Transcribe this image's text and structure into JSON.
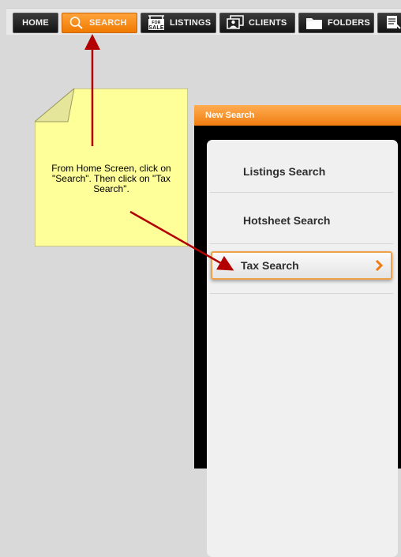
{
  "toolbar": {
    "home": "HOME",
    "search": "SEARCH",
    "listings": "LISTINGS",
    "clients": "CLIENTS",
    "folders": "FOLDERS",
    "for_sale_icon_text": [
      "FOR",
      "SALE"
    ]
  },
  "panel": {
    "title": "New Search",
    "items": [
      "Listings Search",
      "Hotsheet Search",
      "Tax Search"
    ]
  },
  "callout": {
    "text": "From Home Screen, click on \"Search\". Then click on \"Tax Search\"."
  },
  "colors": {
    "accent": "#f07d10",
    "note_fill": "#ffff99",
    "arrow": "#b30000"
  },
  "icons": [
    "search-icon",
    "for-sale-sign-icon",
    "clients-icon",
    "folder-icon",
    "document-icon",
    "chevron-right-icon"
  ]
}
